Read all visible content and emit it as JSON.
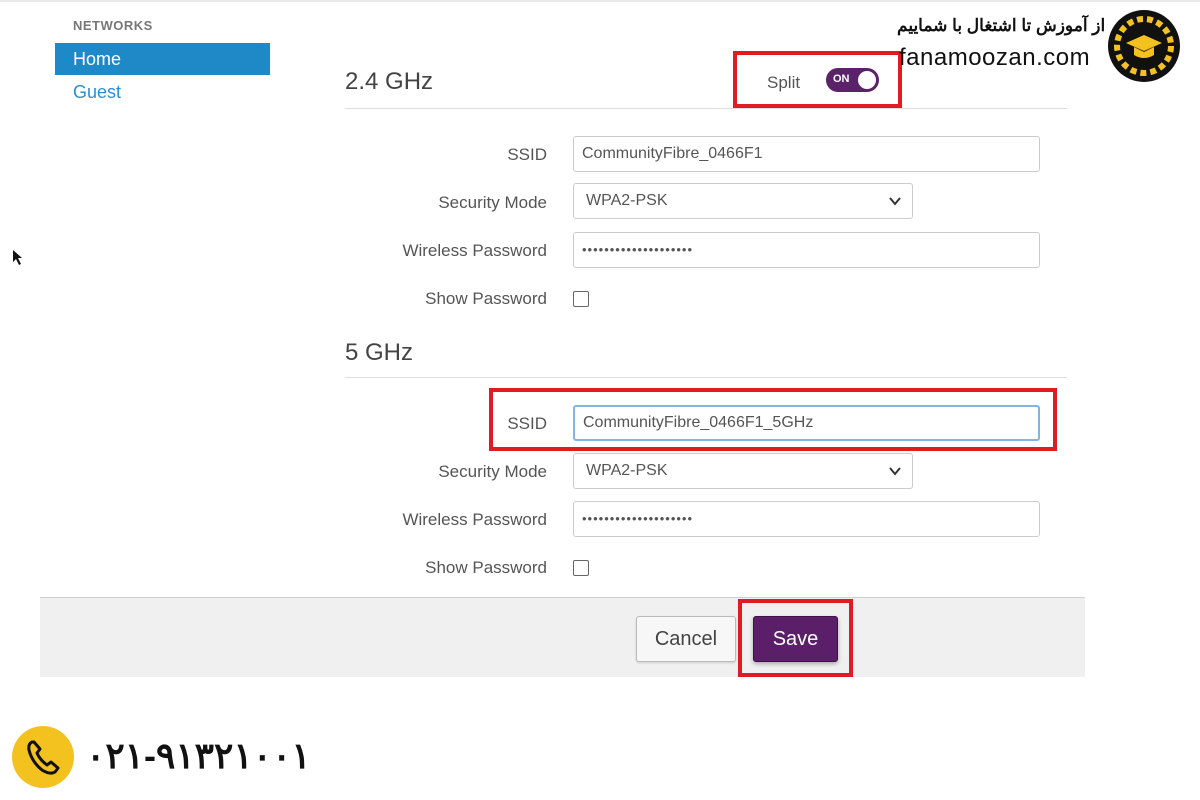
{
  "sidebar": {
    "heading": "NETWORKS",
    "items": [
      {
        "label": "Home",
        "active": true
      },
      {
        "label": "Guest",
        "active": false
      }
    ]
  },
  "split": {
    "label": "Split",
    "state": "ON"
  },
  "band_24": {
    "title": "2.4 GHz",
    "ssid_label": "SSID",
    "ssid_value": "CommunityFibre_0466F1",
    "security_label": "Security Mode",
    "security_value": "WPA2-PSK",
    "password_label": "Wireless Password",
    "password_value": "••••••••••••••••••••",
    "show_password_label": "Show Password"
  },
  "band_5": {
    "title": "5 GHz",
    "ssid_label": "SSID",
    "ssid_value": "CommunityFibre_0466F1_5GHz",
    "security_label": "Security Mode",
    "security_value": "WPA2-PSK",
    "password_label": "Wireless Password",
    "password_value": "••••••••••••••••••••",
    "show_password_label": "Show Password"
  },
  "actions": {
    "cancel_label": "Cancel",
    "save_label": "Save"
  },
  "watermark": {
    "tagline_fa": "از آموزش تا اشتغال با شماییم",
    "site": "fanamoozan.com",
    "phone": "۰۲۱-۹۱۳۲۱۰۰۱"
  },
  "colors": {
    "active_nav": "#1f88c7",
    "brand_purple": "#5b1f6a",
    "highlight_red": "#e01b22",
    "phone_badge": "#f4c21f"
  },
  "icons": [
    "chevron-down-icon",
    "phone-icon",
    "graduation-cap-logo",
    "mouse-cursor-icon"
  ]
}
